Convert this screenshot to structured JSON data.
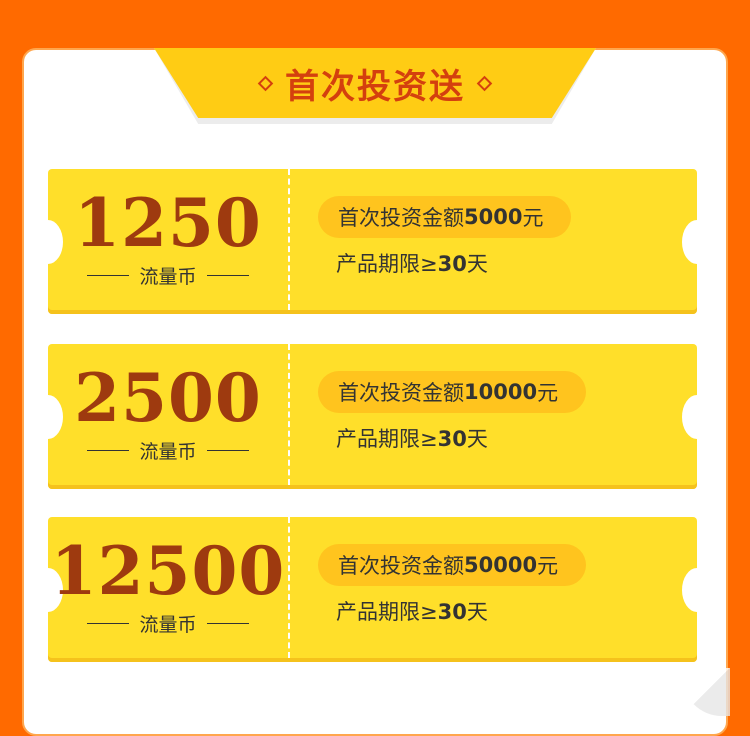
{
  "banner": {
    "title": "首次投资送"
  },
  "coupons": [
    {
      "amount": "1250",
      "unit": "流量币",
      "condition_prefix": "首次投资金额",
      "condition_amount": "5000",
      "condition_suffix": "元",
      "term_prefix": "产品期限≥",
      "term_days": "30",
      "term_suffix": "天"
    },
    {
      "amount": "2500",
      "unit": "流量币",
      "condition_prefix": "首次投资金额",
      "condition_amount": "10000",
      "condition_suffix": "元",
      "term_prefix": "产品期限≥",
      "term_days": "30",
      "term_suffix": "天"
    },
    {
      "amount": "12500",
      "unit": "流量币",
      "condition_prefix": "首次投资金额",
      "condition_amount": "50000",
      "condition_suffix": "元",
      "term_prefix": "产品期限≥",
      "term_days": "30",
      "term_suffix": "天"
    }
  ],
  "colors": {
    "background": "#ff6a00",
    "banner": "#ffcc14",
    "coupon": "#ffdf2a",
    "amount_text": "#9e3a0f",
    "title_text": "#d4400e"
  }
}
